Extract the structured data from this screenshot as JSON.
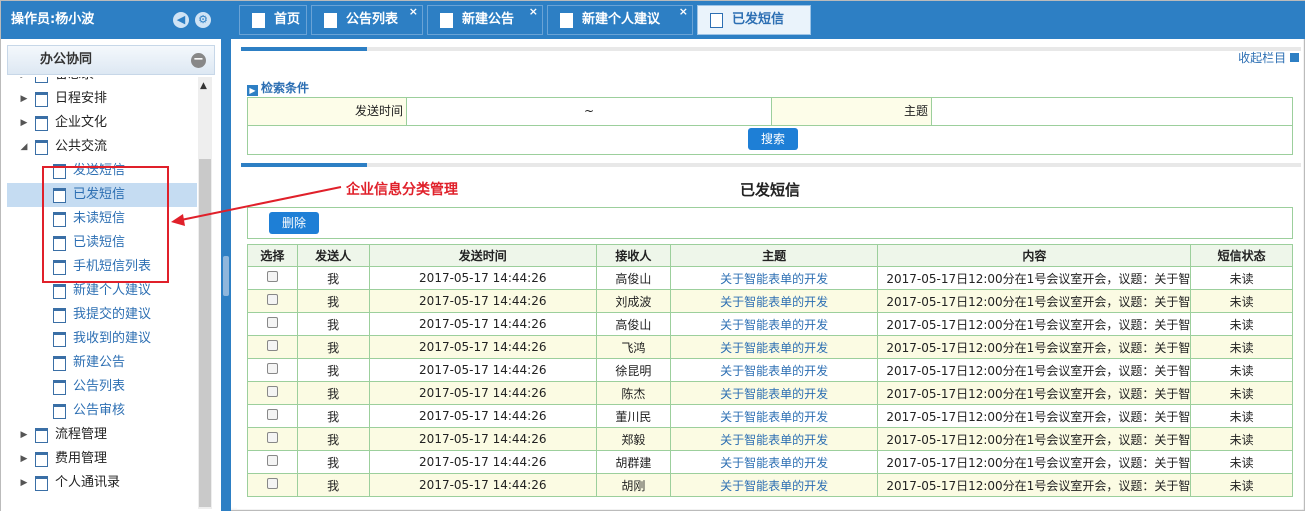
{
  "operator": {
    "label": "操作员:杨小波"
  },
  "sidebar": {
    "section_title": "办公协同",
    "items": [
      {
        "label": "备忘录",
        "level": 0
      },
      {
        "label": "日程安排",
        "level": 0
      },
      {
        "label": "企业文化",
        "level": 0
      },
      {
        "label": "公共交流",
        "level": 0,
        "expanded": true
      },
      {
        "label": "发送短信",
        "level": 1
      },
      {
        "label": "已发短信",
        "level": 1,
        "selected": true
      },
      {
        "label": "未读短信",
        "level": 1
      },
      {
        "label": "已读短信",
        "level": 1
      },
      {
        "label": "手机短信列表",
        "level": 1
      },
      {
        "label": "新建个人建议",
        "level": 1
      },
      {
        "label": "我提交的建议",
        "level": 1
      },
      {
        "label": "我收到的建议",
        "level": 1
      },
      {
        "label": "新建公告",
        "level": 1
      },
      {
        "label": "公告列表",
        "level": 1
      },
      {
        "label": "公告审核",
        "level": 1
      },
      {
        "label": "流程管理",
        "level": 0
      },
      {
        "label": "费用管理",
        "level": 0
      },
      {
        "label": "个人通讯录",
        "level": 0
      }
    ]
  },
  "tabs": [
    {
      "label": "首页",
      "closable": false
    },
    {
      "label": "公告列表",
      "closable": true
    },
    {
      "label": "新建公告",
      "closable": true
    },
    {
      "label": "新建个人建议",
      "closable": true
    },
    {
      "label": "已发短信",
      "closable": false,
      "active": true
    }
  ],
  "main": {
    "collapse_label": "收起栏目",
    "search": {
      "title": "检索条件",
      "send_time_label": "发送时间",
      "range_sep": "~",
      "subject_label": "主题",
      "search_button": "搜索"
    },
    "list_title": "已发短信",
    "delete_button": "删除",
    "columns": [
      "选择",
      "发送人",
      "发送时间",
      "接收人",
      "主题",
      "内容",
      "短信状态"
    ],
    "rows": [
      {
        "sender": "我",
        "time": "2017-05-17 14:44:26",
        "receiver": "高俊山",
        "subject": "关于智能表单的开发",
        "content": "2017-05-17日12:00分在1号会议室开会，议题：关于智",
        "status": "未读"
      },
      {
        "sender": "我",
        "time": "2017-05-17 14:44:26",
        "receiver": "刘成波",
        "subject": "关于智能表单的开发",
        "content": "2017-05-17日12:00分在1号会议室开会，议题：关于智",
        "status": "未读"
      },
      {
        "sender": "我",
        "time": "2017-05-17 14:44:26",
        "receiver": "高俊山",
        "subject": "关于智能表单的开发",
        "content": "2017-05-17日12:00分在1号会议室开会，议题：关于智",
        "status": "未读"
      },
      {
        "sender": "我",
        "time": "2017-05-17 14:44:26",
        "receiver": "飞鸿",
        "subject": "关于智能表单的开发",
        "content": "2017-05-17日12:00分在1号会议室开会，议题：关于智",
        "status": "未读"
      },
      {
        "sender": "我",
        "time": "2017-05-17 14:44:26",
        "receiver": "徐昆明",
        "subject": "关于智能表单的开发",
        "content": "2017-05-17日12:00分在1号会议室开会，议题：关于智",
        "status": "未读"
      },
      {
        "sender": "我",
        "time": "2017-05-17 14:44:26",
        "receiver": "陈杰",
        "subject": "关于智能表单的开发",
        "content": "2017-05-17日12:00分在1号会议室开会，议题：关于智",
        "status": "未读"
      },
      {
        "sender": "我",
        "time": "2017-05-17 14:44:26",
        "receiver": "董川民",
        "subject": "关于智能表单的开发",
        "content": "2017-05-17日12:00分在1号会议室开会，议题：关于智",
        "status": "未读"
      },
      {
        "sender": "我",
        "time": "2017-05-17 14:44:26",
        "receiver": "郑毅",
        "subject": "关于智能表单的开发",
        "content": "2017-05-17日12:00分在1号会议室开会，议题：关于智",
        "status": "未读"
      },
      {
        "sender": "我",
        "time": "2017-05-17 14:44:26",
        "receiver": "胡群建",
        "subject": "关于智能表单的开发",
        "content": "2017-05-17日12:00分在1号会议室开会，议题：关于智",
        "status": "未读"
      },
      {
        "sender": "我",
        "time": "2017-05-17 14:44:26",
        "receiver": "胡刚",
        "subject": "关于智能表单的开发",
        "content": "2017-05-17日12:00分在1号会议室开会，议题：关于智",
        "status": "未读"
      }
    ]
  },
  "annotation": {
    "label": "企业信息分类管理",
    "color": "#e0202a"
  },
  "colors": {
    "brand": "#2d7fc4",
    "button": "#1e7fd6",
    "link": "#2d6fb3",
    "grid_border": "#9ccf9c",
    "alt_row": "#fbfbe3"
  }
}
